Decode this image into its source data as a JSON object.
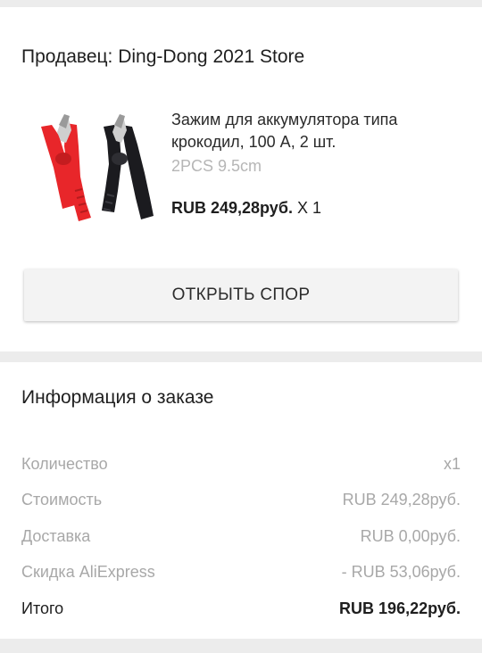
{
  "seller": {
    "title": "Продавец: Ding-Dong 2021 Store"
  },
  "product": {
    "image": "red-and-black-crocodile-clips-image",
    "title": "Зажим для аккумулятора типа крокодил, 100 А, 2 шт.",
    "sku": "2PCS 9.5cm",
    "price": "RUB 249,28руб.",
    "quantity": "X 1"
  },
  "dispute_button": {
    "label": "ОТКРЫТЬ СПОР"
  },
  "order_info": {
    "title": "Информация о заказе",
    "rows": [
      {
        "label": "Количество",
        "value": "x1"
      },
      {
        "label": "Стоимость",
        "value": "RUB 249,28руб."
      },
      {
        "label": "Доставка",
        "value": "RUB 0,00руб."
      },
      {
        "label": "Скидка AliExpress",
        "value": "- RUB 53,06руб."
      },
      {
        "label": "Итого",
        "value": "RUB 196,22руб."
      }
    ]
  },
  "colors": {
    "background": "#ececec",
    "card": "#ffffff",
    "clip_red": "#e8262a",
    "clip_black": "#1b1b1f",
    "muted_text": "#a8a8a8"
  }
}
